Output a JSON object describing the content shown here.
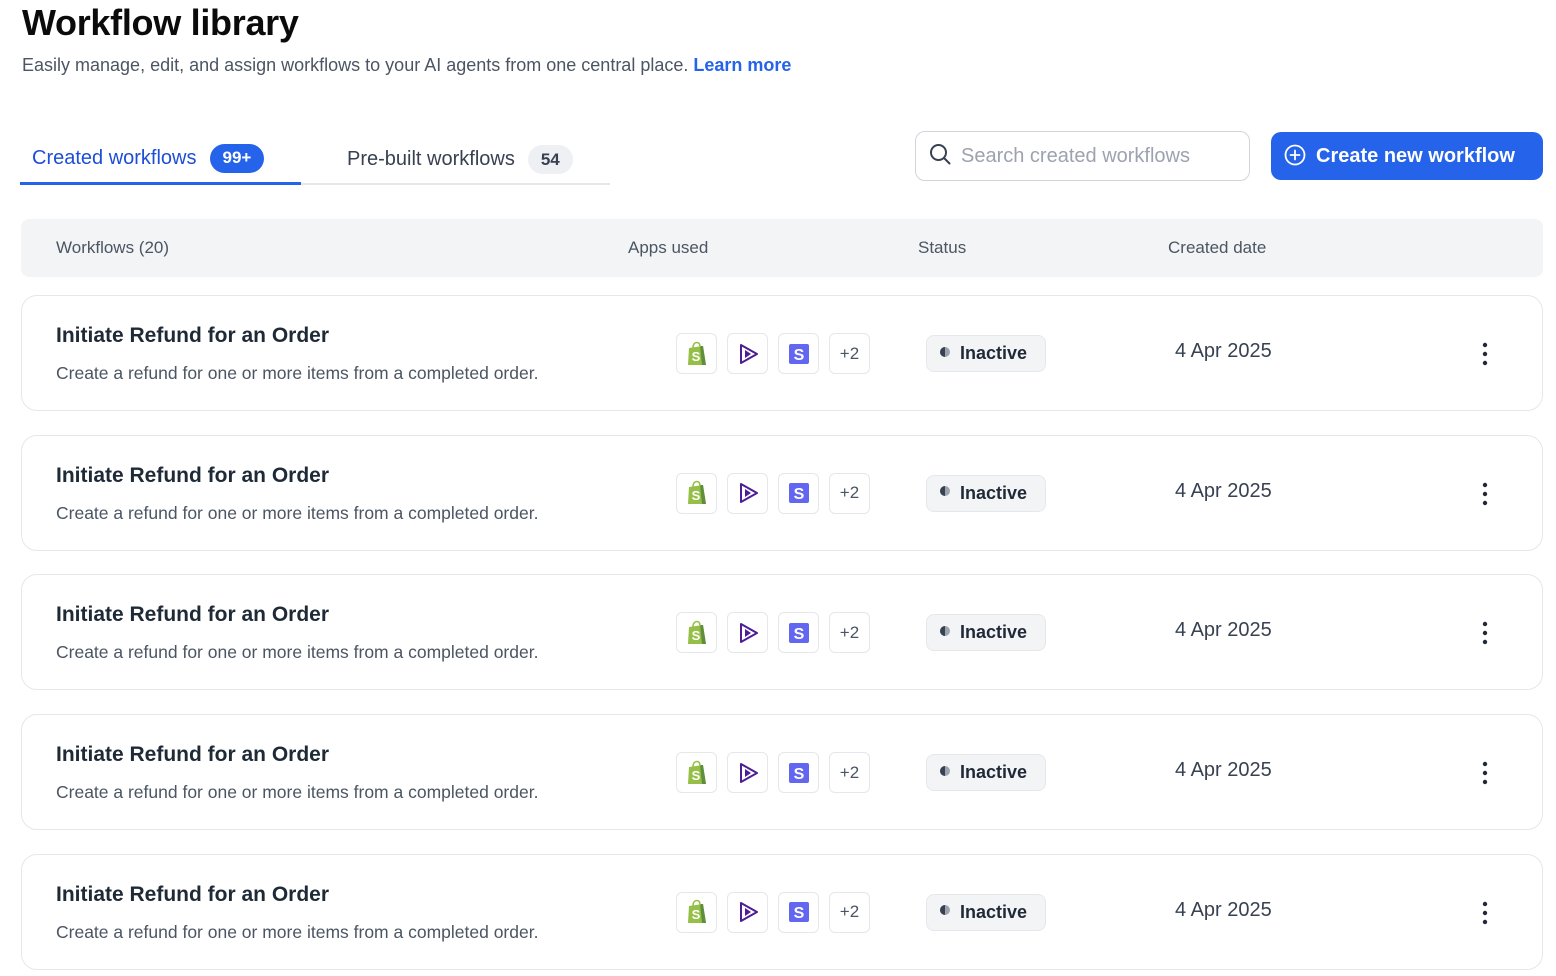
{
  "header": {
    "title": "Workflow library",
    "subtitle": "Easily manage, edit, and assign workflows to your AI agents from one central place.",
    "learn_more": "Learn more"
  },
  "tabs": [
    {
      "label": "Created workflows",
      "badge": "99+",
      "active": true
    },
    {
      "label": "Pre-built workflows",
      "badge": "54",
      "active": false
    }
  ],
  "search": {
    "placeholder": "Search created workflows",
    "icon": "search-icon"
  },
  "create_button": {
    "label": "Create new workflow",
    "icon": "plus-circle-icon"
  },
  "table": {
    "columns": {
      "workflows": "Workflows (20)",
      "apps": "Apps used",
      "status": "Status",
      "created": "Created date"
    },
    "rows": [
      {
        "title": "Initiate Refund for an Order",
        "description": "Create a refund for one or more items from a completed order.",
        "apps": [
          "shopify-icon",
          "play-app-icon",
          "s-app-icon"
        ],
        "apps_more": "+2",
        "status": "Inactive",
        "date": "4 Apr 2025"
      },
      {
        "title": "Initiate Refund for an Order",
        "description": "Create a refund for one or more items from a completed order.",
        "apps": [
          "shopify-icon",
          "play-app-icon",
          "s-app-icon"
        ],
        "apps_more": "+2",
        "status": "Inactive",
        "date": "4 Apr 2025"
      },
      {
        "title": "Initiate Refund for an Order",
        "description": "Create a refund for one or more items from a completed order.",
        "apps": [
          "shopify-icon",
          "play-app-icon",
          "s-app-icon"
        ],
        "apps_more": "+2",
        "status": "Inactive",
        "date": "4 Apr 2025"
      },
      {
        "title": "Initiate Refund for an Order",
        "description": "Create a refund for one or more items from a completed order.",
        "apps": [
          "shopify-icon",
          "play-app-icon",
          "s-app-icon"
        ],
        "apps_more": "+2",
        "status": "Inactive",
        "date": "4 Apr 2025"
      },
      {
        "title": "Initiate Refund for an Order",
        "description": "Create a refund for one or more items from a completed order.",
        "apps": [
          "shopify-icon",
          "play-app-icon",
          "s-app-icon"
        ],
        "apps_more": "+2",
        "status": "Inactive",
        "date": "4 Apr 2025"
      }
    ]
  },
  "colors": {
    "accent": "#2563eb",
    "shopify": "#95bf47",
    "play_app": "#4c1d95",
    "s_app": "#6366f1"
  }
}
